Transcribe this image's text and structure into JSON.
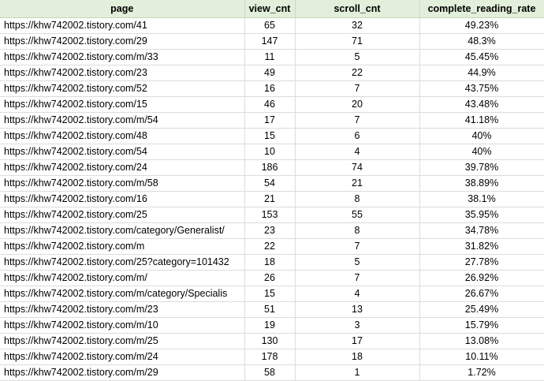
{
  "table": {
    "headers": [
      "page",
      "view_cnt",
      "scroll_cnt",
      "complete_reading_rate"
    ],
    "rows": [
      [
        "https://khw742002.tistory.com/41",
        "65",
        "32",
        "49.23%"
      ],
      [
        "https://khw742002.tistory.com/29",
        "147",
        "71",
        "48.3%"
      ],
      [
        "https://khw742002.tistory.com/m/33",
        "11",
        "5",
        "45.45%"
      ],
      [
        "https://khw742002.tistory.com/23",
        "49",
        "22",
        "44.9%"
      ],
      [
        "https://khw742002.tistory.com/52",
        "16",
        "7",
        "43.75%"
      ],
      [
        "https://khw742002.tistory.com/15",
        "46",
        "20",
        "43.48%"
      ],
      [
        "https://khw742002.tistory.com/m/54",
        "17",
        "7",
        "41.18%"
      ],
      [
        "https://khw742002.tistory.com/48",
        "15",
        "6",
        "40%"
      ],
      [
        "https://khw742002.tistory.com/54",
        "10",
        "4",
        "40%"
      ],
      [
        "https://khw742002.tistory.com/24",
        "186",
        "74",
        "39.78%"
      ],
      [
        "https://khw742002.tistory.com/m/58",
        "54",
        "21",
        "38.89%"
      ],
      [
        "https://khw742002.tistory.com/16",
        "21",
        "8",
        "38.1%"
      ],
      [
        "https://khw742002.tistory.com/25",
        "153",
        "55",
        "35.95%"
      ],
      [
        "https://khw742002.tistory.com/category/Generalist/",
        "23",
        "8",
        "34.78%"
      ],
      [
        "https://khw742002.tistory.com/m",
        "22",
        "7",
        "31.82%"
      ],
      [
        "https://khw742002.tistory.com/25?category=101432",
        "18",
        "5",
        "27.78%"
      ],
      [
        "https://khw742002.tistory.com/m/",
        "26",
        "7",
        "26.92%"
      ],
      [
        "https://khw742002.tistory.com/m/category/Specialis",
        "15",
        "4",
        "26.67%"
      ],
      [
        "https://khw742002.tistory.com/m/23",
        "51",
        "13",
        "25.49%"
      ],
      [
        "https://khw742002.tistory.com/m/10",
        "19",
        "3",
        "15.79%"
      ],
      [
        "https://khw742002.tistory.com/m/25",
        "130",
        "17",
        "13.08%"
      ],
      [
        "https://khw742002.tistory.com/m/24",
        "178",
        "18",
        "10.11%"
      ],
      [
        "https://khw742002.tistory.com/m/29",
        "58",
        "1",
        "1.72%"
      ]
    ]
  },
  "colors": {
    "header_bg": "#e2efda",
    "grid_line": "#dcdcdc"
  }
}
